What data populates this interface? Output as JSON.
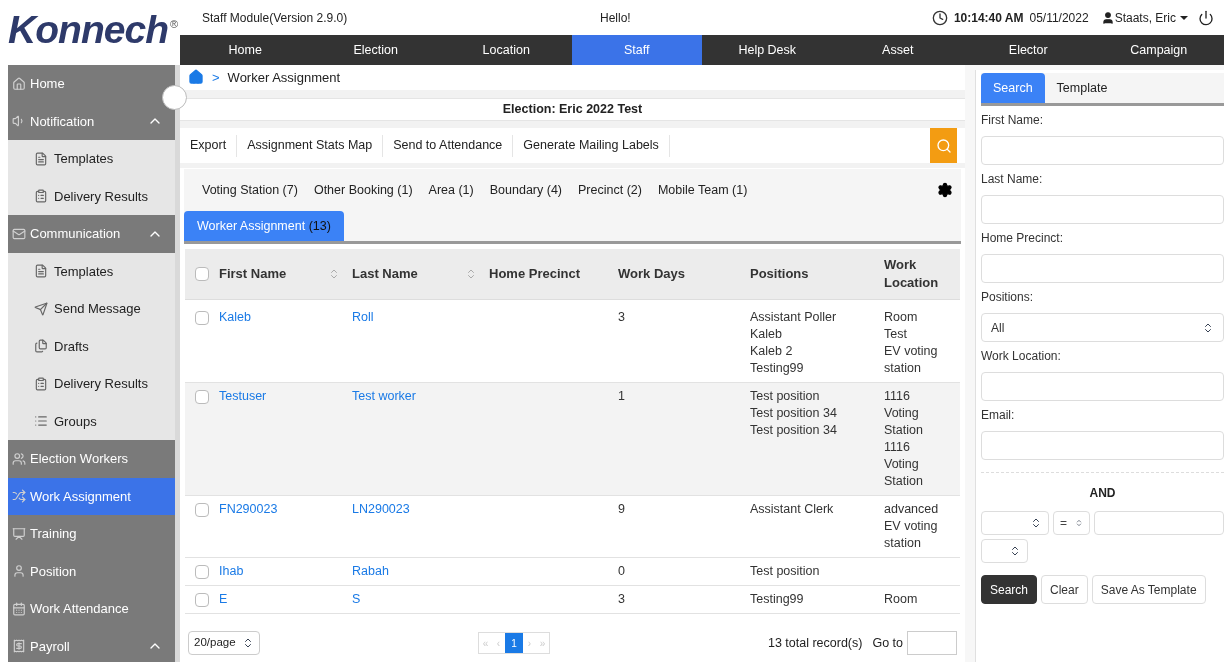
{
  "header": {
    "logo": "Konnech",
    "logo_mark": "®",
    "module": "Staff Module(Version 2.9.0)",
    "greeting": "Hello!",
    "time": "10:14:40 AM",
    "date": "05/11/2022",
    "user": "Staats, Eric"
  },
  "nav": [
    {
      "label": "Home",
      "selected": false
    },
    {
      "label": "Election",
      "selected": false
    },
    {
      "label": "Location",
      "selected": false
    },
    {
      "label": "Staff",
      "selected": true
    },
    {
      "label": "Help Desk",
      "selected": false
    },
    {
      "label": "Asset",
      "selected": false
    },
    {
      "label": "Elector",
      "selected": false
    },
    {
      "label": "Campaign",
      "selected": false
    }
  ],
  "sidebar": {
    "items": [
      {
        "kind": "section",
        "label": "Home",
        "selected": false
      },
      {
        "kind": "section",
        "label": "Notification",
        "selected": false,
        "expanded": true,
        "children": [
          {
            "label": "Templates",
            "selected": false
          },
          {
            "label": "Delivery Results",
            "selected": false
          }
        ]
      },
      {
        "kind": "section",
        "label": "Communication",
        "selected": false,
        "expanded": true,
        "children": [
          {
            "label": "Templates",
            "selected": false
          },
          {
            "label": "Send Message",
            "selected": false
          },
          {
            "label": "Drafts",
            "selected": false
          },
          {
            "label": "Delivery Results",
            "selected": false
          },
          {
            "label": "Groups",
            "selected": false
          }
        ]
      },
      {
        "kind": "section",
        "label": "Election Workers",
        "selected": false
      },
      {
        "kind": "section",
        "label": "Work Assignment",
        "selected": true
      },
      {
        "kind": "section",
        "label": "Training",
        "selected": false
      },
      {
        "kind": "section",
        "label": "Position",
        "selected": false
      },
      {
        "kind": "section",
        "label": "Work Attendance",
        "selected": false
      },
      {
        "kind": "section",
        "label": "Payroll",
        "selected": false,
        "expanded": true
      }
    ]
  },
  "breadcrumb": {
    "separator": ">",
    "current": "Worker Assignment"
  },
  "election_title": "Election: Eric 2022 Test",
  "toolbar": [
    "Export",
    "Assignment Stats Map",
    "Send to Attendance",
    "Generate Mailing Labels"
  ],
  "filter_tabs": [
    {
      "label": "Voting Station (7)",
      "selected": false
    },
    {
      "label": "Other Booking (1)",
      "selected": false
    },
    {
      "label": "Area (1)",
      "selected": false
    },
    {
      "label": "Boundary (4)",
      "selected": false
    },
    {
      "label": "Precinct (2)",
      "selected": false
    },
    {
      "label": "Mobile Team (1)",
      "selected": false
    }
  ],
  "view_tabs": [
    {
      "label": "Worker Assignment",
      "count": "(13)",
      "selected": true
    }
  ],
  "table": {
    "all_checked": false,
    "columns": [
      {
        "label": "First Name",
        "sortable": true
      },
      {
        "label": "Last Name",
        "sortable": true
      },
      {
        "label": "Home Precinct",
        "sortable": false
      },
      {
        "label": "Work Days",
        "sortable": false
      },
      {
        "label": "Positions",
        "sortable": false
      },
      {
        "label": "Work Location",
        "sortable": false
      }
    ],
    "rows": [
      {
        "checked": false,
        "highlighted": false,
        "first_name": "Kaleb",
        "last_name": "Roll",
        "home_precinct": "",
        "work_days": "3",
        "positions": [
          "Assistant Poller",
          "Kaleb",
          "Kaleb 2",
          "Testing99"
        ],
        "work_location": [
          "Room",
          "Test",
          "EV voting",
          "station"
        ]
      },
      {
        "checked": false,
        "highlighted": true,
        "first_name": "Testuser",
        "last_name": "Test worker",
        "home_precinct": "",
        "work_days": "1",
        "positions": [
          "Test position",
          "Test position 34",
          "Test position 34"
        ],
        "work_location": [
          "1116",
          "Voting",
          "Station",
          "1116",
          "Voting",
          "Station"
        ]
      },
      {
        "checked": false,
        "highlighted": false,
        "first_name": "FN290023",
        "last_name": "LN290023",
        "home_precinct": "",
        "work_days": "9",
        "positions": [
          "Assistant Clerk"
        ],
        "work_location": [
          "advanced",
          "EV voting",
          "station"
        ]
      },
      {
        "checked": false,
        "highlighted": false,
        "first_name": "Ihab",
        "last_name": "Rabah",
        "home_precinct": "",
        "work_days": "0",
        "positions": [
          "Test position"
        ],
        "work_location": []
      },
      {
        "checked": false,
        "highlighted": false,
        "first_name": "E",
        "last_name": "S",
        "home_precinct": "",
        "work_days": "3",
        "positions": [
          "Testing99"
        ],
        "work_location": [
          "Room"
        ]
      }
    ]
  },
  "pagination": {
    "page_size": "20/page",
    "first": "«",
    "prev": "‹",
    "pages": [
      {
        "label": "1",
        "selected": true
      }
    ],
    "next": "›",
    "last": "»",
    "total": "13 total record(s)",
    "goto": "Go to"
  },
  "search_panel": {
    "tabs": [
      {
        "label": "Search",
        "selected": true
      },
      {
        "label": "Template",
        "selected": false
      }
    ],
    "fields": [
      {
        "kind": "input",
        "label": "First Name:"
      },
      {
        "kind": "input",
        "label": "Last Name:"
      },
      {
        "kind": "input",
        "label": "Home Precinct:"
      },
      {
        "kind": "select",
        "label": "Positions:",
        "value": "All"
      },
      {
        "kind": "input",
        "label": "Work Location:"
      },
      {
        "kind": "input",
        "label": "Email:"
      }
    ],
    "logic": "AND",
    "condition": [
      {
        "kind": "select"
      },
      {
        "kind": "select",
        "value": "="
      },
      {
        "kind": "input"
      },
      {
        "kind": "select"
      }
    ],
    "buttons": [
      {
        "label": "Search",
        "kind": "primary"
      },
      {
        "label": "Clear",
        "kind": "default"
      },
      {
        "label": "Save As Template",
        "kind": "default"
      }
    ]
  }
}
